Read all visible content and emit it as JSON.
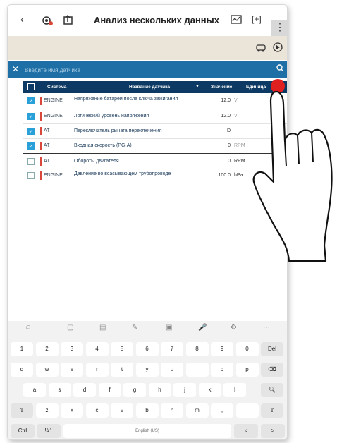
{
  "topbar": {
    "back_icon": "back-chevron-icon",
    "title": "Анализ нескольких данных",
    "menu_label": "⋮"
  },
  "search": {
    "placeholder": "Введите имя датчика"
  },
  "table": {
    "headers": {
      "system": "Система",
      "sensor_name": "Название датчика",
      "value": "Значение",
      "unit": "Единица"
    },
    "rows": [
      {
        "checked": true,
        "system": "ENGINE",
        "name": "Напряжение батареи после ключа зажигания",
        "value": "12.0",
        "unit": "V"
      },
      {
        "checked": true,
        "system": "ENGINE",
        "name": "Логический уровень напряжения",
        "value": "12.0",
        "unit": "V"
      },
      {
        "checked": true,
        "system": "AT",
        "name": "Переключатель рычага переключения",
        "value": "D",
        "unit": ""
      },
      {
        "checked": true,
        "system": "AT",
        "name": "Входная скорость (PG-A)",
        "value": "0",
        "unit": "RPM"
      },
      {
        "checked": false,
        "system": "AT",
        "name": "Обороты двигателя",
        "value": "0",
        "unit": "RPM"
      },
      {
        "checked": false,
        "system": "ENGINE",
        "name": "Давление во всасывающем трубопроводе",
        "value": "100.0",
        "unit": "hPa"
      }
    ]
  },
  "keyboard": {
    "row1": [
      "1",
      "2",
      "3",
      "4",
      "5",
      "6",
      "7",
      "8",
      "9",
      "0",
      "Del"
    ],
    "row2": [
      "q",
      "w",
      "e",
      "r",
      "t",
      "y",
      "u",
      "i",
      "o",
      "p"
    ],
    "row2_sup": [
      "",
      "",
      "",
      "",
      "",
      "",
      "",
      "",
      "",
      ""
    ],
    "row3": [
      "a",
      "s",
      "d",
      "f",
      "g",
      "h",
      "j",
      "k",
      "l"
    ],
    "row4": [
      "z",
      "x",
      "c",
      "v",
      "b",
      "n",
      "m",
      ",",
      "."
    ],
    "bottom": {
      "ctrl": "Ctrl",
      "sym": "!#1",
      "space": "English (US)",
      "left": "<",
      "right": ">"
    }
  },
  "colors": {
    "header_bg": "#0d3a64",
    "search_bg": "#1d6fa5",
    "system_marker": "#d9473a",
    "check_on": "#2aa0d8",
    "touch_dot": "#e02020"
  }
}
